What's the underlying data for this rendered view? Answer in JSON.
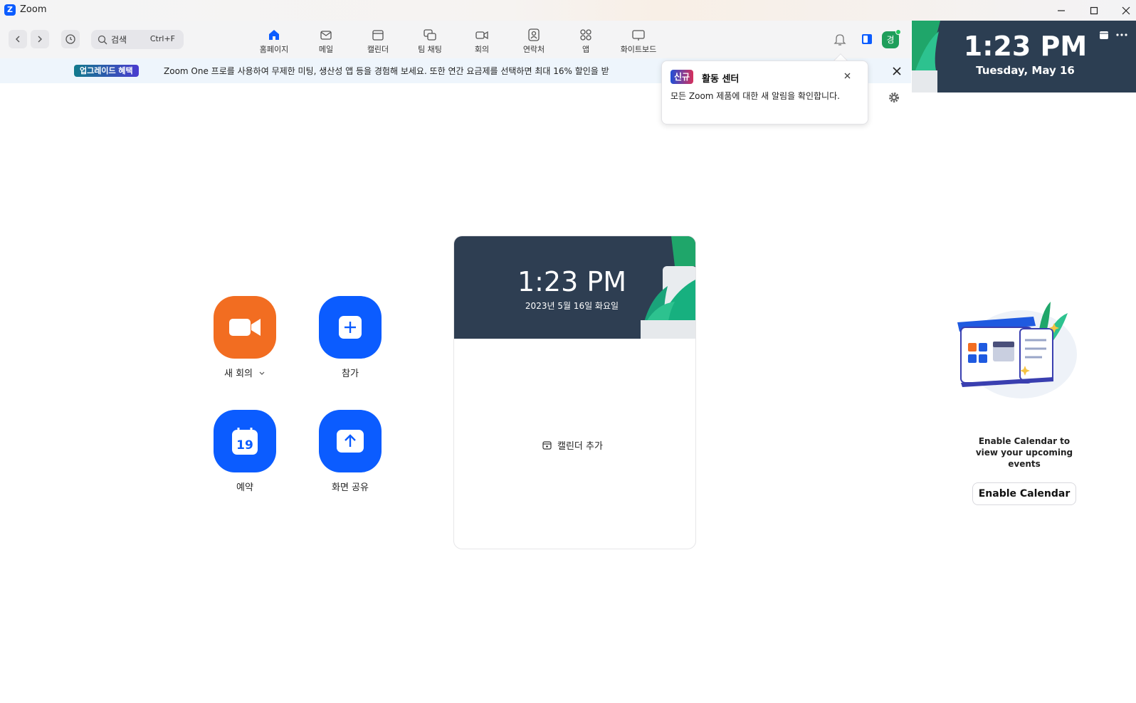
{
  "window": {
    "title": "Zoom",
    "logo_letter": "Z"
  },
  "search": {
    "placeholder": "검색",
    "shortcut": "Ctrl+F"
  },
  "tabs": [
    {
      "label": "홈페이지",
      "icon": "home-icon",
      "active": true
    },
    {
      "label": "메일",
      "icon": "mail-icon"
    },
    {
      "label": "캘린더",
      "icon": "calendar-icon"
    },
    {
      "label": "팀 채팅",
      "icon": "team-chat-icon"
    },
    {
      "label": "회의",
      "icon": "video-icon"
    },
    {
      "label": "연락처",
      "icon": "contacts-icon"
    },
    {
      "label": "앱",
      "icon": "apps-icon"
    },
    {
      "label": "화이트보드",
      "icon": "whiteboard-icon"
    }
  ],
  "user": {
    "avatar_initial": "경",
    "status_color": "#22c55e"
  },
  "banner": {
    "badge": "업그레이드 혜택",
    "text": "Zoom One 프로를 사용하여 무제한 미팅, 생산성 앱 등을 경험해 보세요. 또한 연간 요금제를 선택하면 최대 16% 할인을 받"
  },
  "popup": {
    "badge": "신규",
    "title": "활동 센터",
    "body": "모든 Zoom 제품에 대한 새 알림을 확인합니다."
  },
  "actions": {
    "new_meeting": "새 회의",
    "join": "참가",
    "schedule": "예약",
    "schedule_day": "19",
    "share_screen": "화면 공유"
  },
  "card": {
    "time": "1:23 PM",
    "date": "2023년 5월 16일 화요일",
    "add_calendar": "캘린더 추가"
  },
  "side_panel": {
    "time": "1:23 PM",
    "date": "Tuesday, May 16",
    "enable_text": "Enable Calendar to view your upcoming events",
    "enable_button": "Enable Calendar"
  },
  "colors": {
    "accent": "#0b5cff",
    "orange": "#f26d21",
    "header_dark": "#2e3e52"
  }
}
